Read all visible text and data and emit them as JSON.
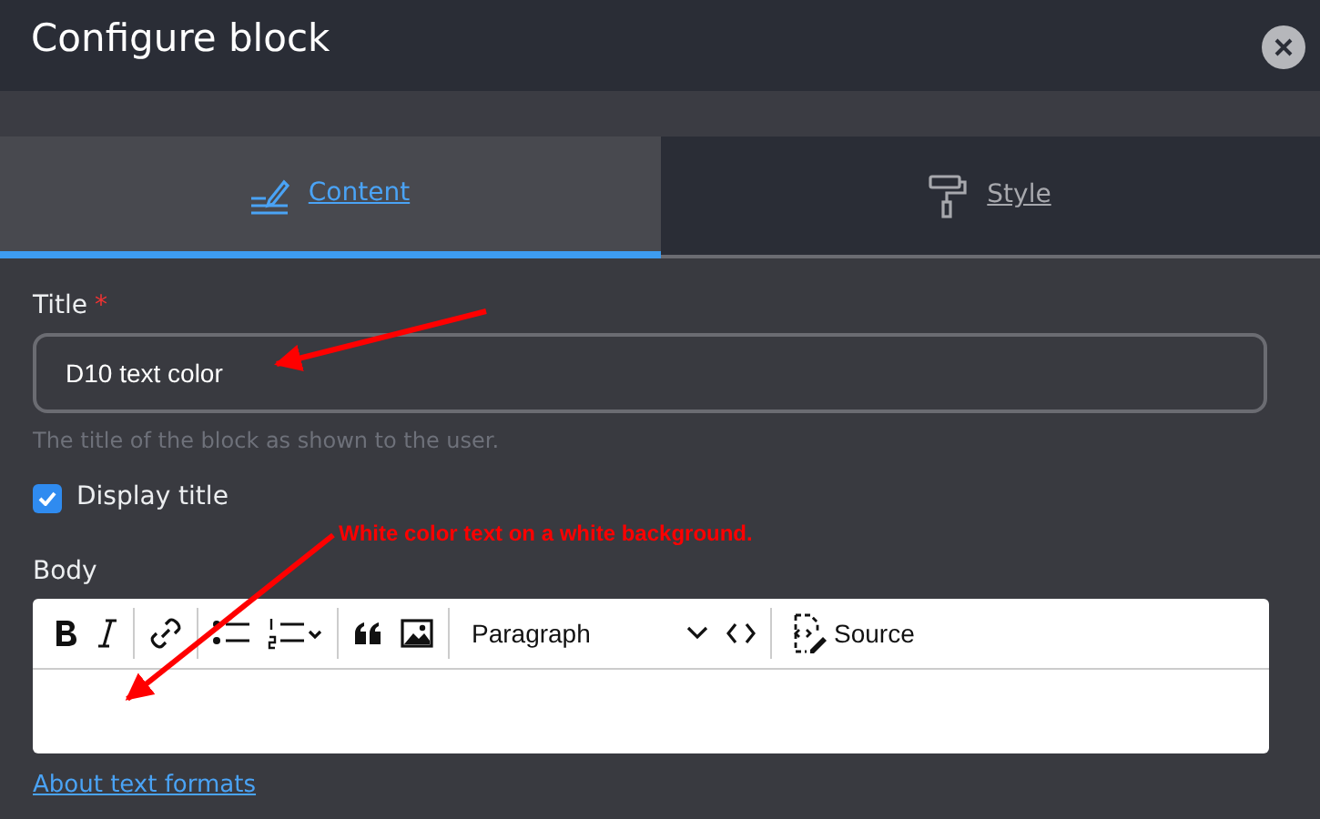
{
  "dialog": {
    "title": "Configure block"
  },
  "tabs": [
    {
      "label": "Content",
      "selected": true,
      "kind": "content"
    },
    {
      "label": "Style",
      "selected": false,
      "kind": "style"
    }
  ],
  "title_field": {
    "label": "Title",
    "required": true,
    "required_mark": "*",
    "value": "D10 text color",
    "description": "The title of the block as shown to the user."
  },
  "display_title": {
    "label": "Display title",
    "checked": true
  },
  "annotation": {
    "text": "White color text on a white background."
  },
  "body": {
    "label": "Body",
    "toolbar": [
      {
        "kind": "bold"
      },
      {
        "kind": "italic"
      },
      {
        "kind": "separator"
      },
      {
        "kind": "link"
      },
      {
        "kind": "separator"
      },
      {
        "kind": "bullets"
      },
      {
        "kind": "numbered"
      },
      {
        "kind": "separator"
      },
      {
        "kind": "quote"
      },
      {
        "kind": "image"
      },
      {
        "kind": "separator"
      },
      {
        "kind": "heading",
        "label": "Paragraph"
      },
      {
        "kind": "code"
      },
      {
        "kind": "separator"
      },
      {
        "kind": "source",
        "label": "Source"
      }
    ]
  },
  "formats_link": "About text formats"
}
